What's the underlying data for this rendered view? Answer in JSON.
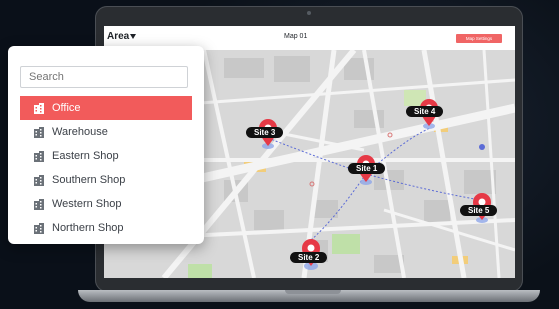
{
  "app": {
    "area_label": "Area",
    "map_title": "Map 01",
    "settings_label": "Map Settings"
  },
  "search": {
    "placeholder": "Search",
    "value": ""
  },
  "locations": [
    {
      "label": "Office",
      "selected": true
    },
    {
      "label": "Warehouse",
      "selected": false
    },
    {
      "label": "Eastern Shop",
      "selected": false
    },
    {
      "label": "Southern Shop",
      "selected": false
    },
    {
      "label": "Western Shop",
      "selected": false
    },
    {
      "label": "Northern Shop",
      "selected": false
    }
  ],
  "sites": [
    {
      "label": "Site 1"
    },
    {
      "label": "Site 2"
    },
    {
      "label": "Site 3"
    },
    {
      "label": "Site 4"
    },
    {
      "label": "Site 5"
    }
  ],
  "colors": {
    "accent": "#f25b5b",
    "pin_red": "#e63946",
    "route": "#5b6bd6"
  },
  "icons": {
    "building": "building-icon",
    "pin": "map-pin-icon",
    "caret": "caret-down-icon"
  }
}
